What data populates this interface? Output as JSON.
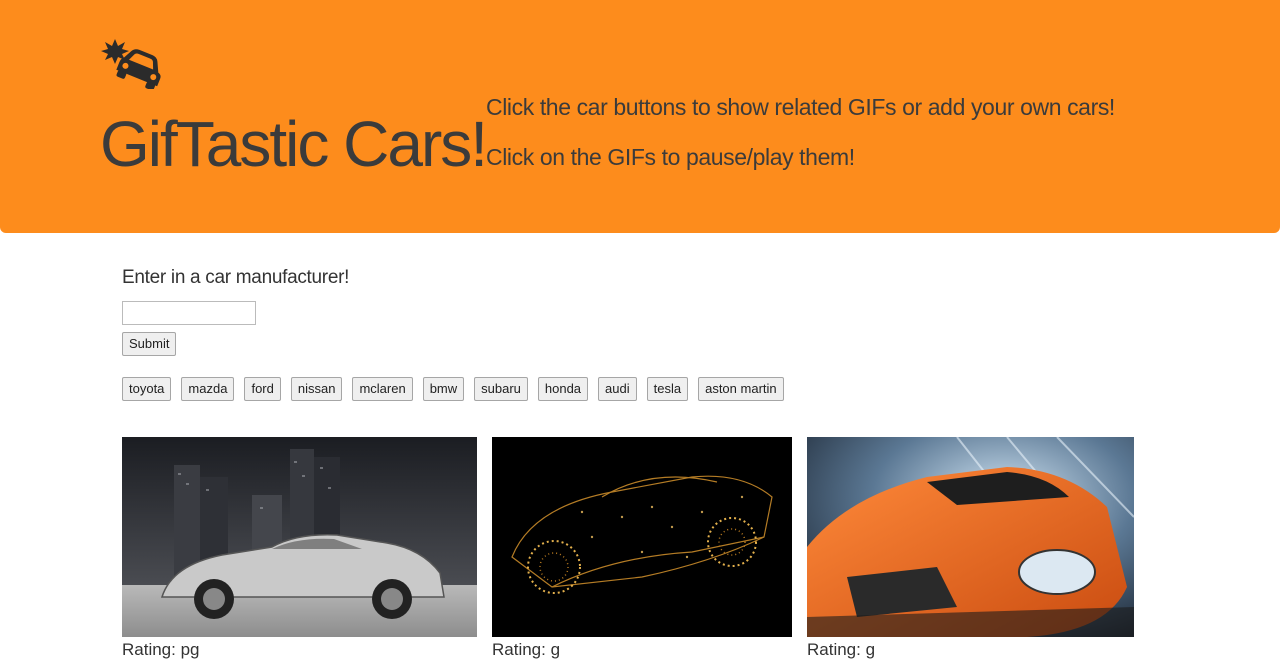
{
  "header": {
    "title": "GifTastic Cars!",
    "intro_line1": "Click the car buttons to show related GIFs or add your own cars!",
    "intro_line2": "Click on the GIFs to pause/play them!",
    "logo_icon": "car-crash-icon"
  },
  "form": {
    "label": "Enter in a car manufacturer!",
    "input_value": "",
    "submit_label": "Submit"
  },
  "car_buttons": [
    "toyota",
    "mazda",
    "ford",
    "nissan",
    "mclaren",
    "bmw",
    "subaru",
    "honda",
    "audi",
    "tesla",
    "aston martin"
  ],
  "gifs": [
    {
      "rating_text": "Rating: pg"
    },
    {
      "rating_text": "Rating: g"
    },
    {
      "rating_text": "Rating: g"
    }
  ],
  "colors": {
    "header_bg": "#fd8c1c",
    "header_text": "#3b3b3b"
  }
}
